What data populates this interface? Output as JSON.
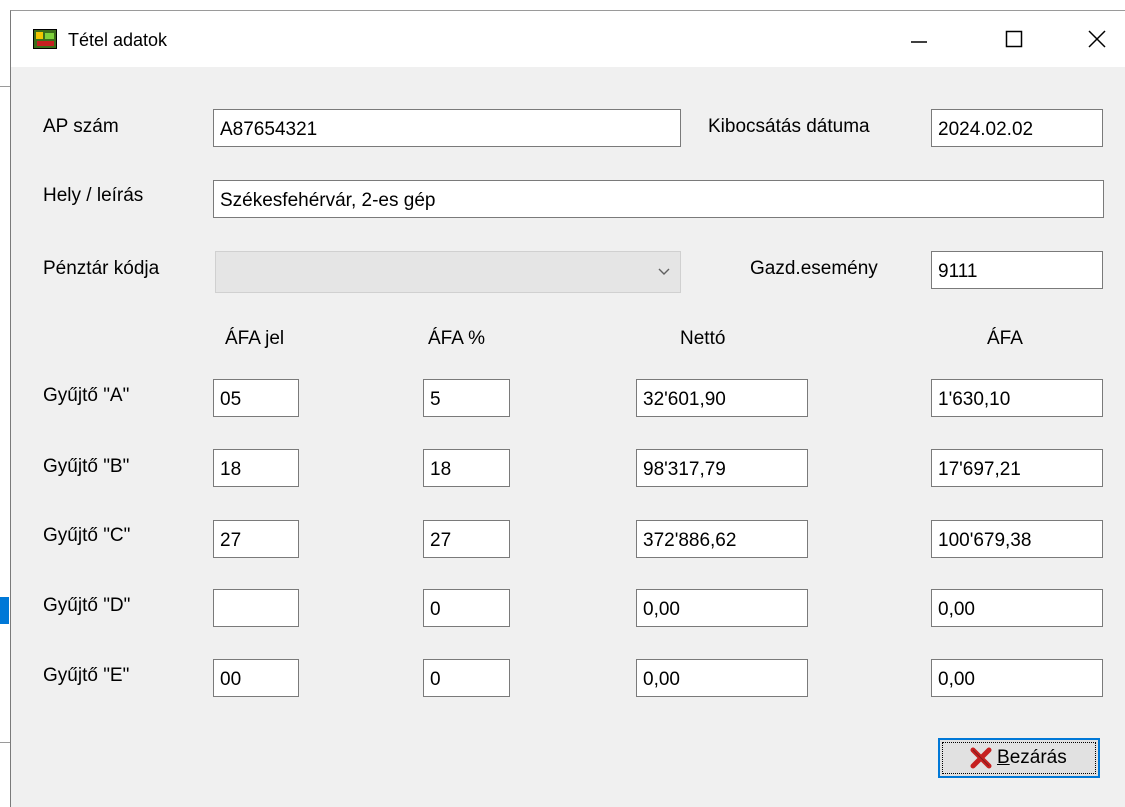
{
  "window": {
    "title": "Tétel adatok",
    "controls": {
      "minimize_icon": "minimize-icon",
      "maximize_icon": "maximize-icon",
      "close_icon": "close-icon"
    }
  },
  "form": {
    "ap_label": "AP szám",
    "ap_value": "A87654321",
    "issue_date_label": "Kibocsátás dátuma",
    "issue_date_value": "2024.02.02",
    "location_label": "Hely / leírás",
    "location_value": "Székesfehérvár, 2-es gép",
    "register_label": "Pénztár kódja",
    "register_value": "",
    "event_label": "Gazd.esemény",
    "event_value": "9111"
  },
  "table": {
    "headers": [
      "ÁFA jel",
      "ÁFA %",
      "Nettó",
      "ÁFA"
    ],
    "rows": [
      {
        "label": "Gyűjtő \"A\"",
        "vat_code": "05",
        "vat_percent": "5",
        "net": "32'601,90",
        "vat": "1'630,10"
      },
      {
        "label": "Gyűjtő \"B\"",
        "vat_code": "18",
        "vat_percent": "18",
        "net": "98'317,79",
        "vat": "17'697,21"
      },
      {
        "label": "Gyűjtő \"C\"",
        "vat_code": "27",
        "vat_percent": "27",
        "net": "372'886,62",
        "vat": "100'679,38"
      },
      {
        "label": "Gyűjtő \"D\"",
        "vat_code": "",
        "vat_percent": "0",
        "net": "0,00",
        "vat": "0,00"
      },
      {
        "label": "Gyűjtő \"E\"",
        "vat_code": "00",
        "vat_percent": "0",
        "net": "0,00",
        "vat": "0,00"
      }
    ]
  },
  "buttons": {
    "close_mnemonic": "B",
    "close_rest": "ezárás",
    "close_icon": "red-x-icon"
  },
  "colors": {
    "focus_border": "#0078d7",
    "close_icon": "#c62020",
    "dialog_bg": "#f0f0f0"
  }
}
